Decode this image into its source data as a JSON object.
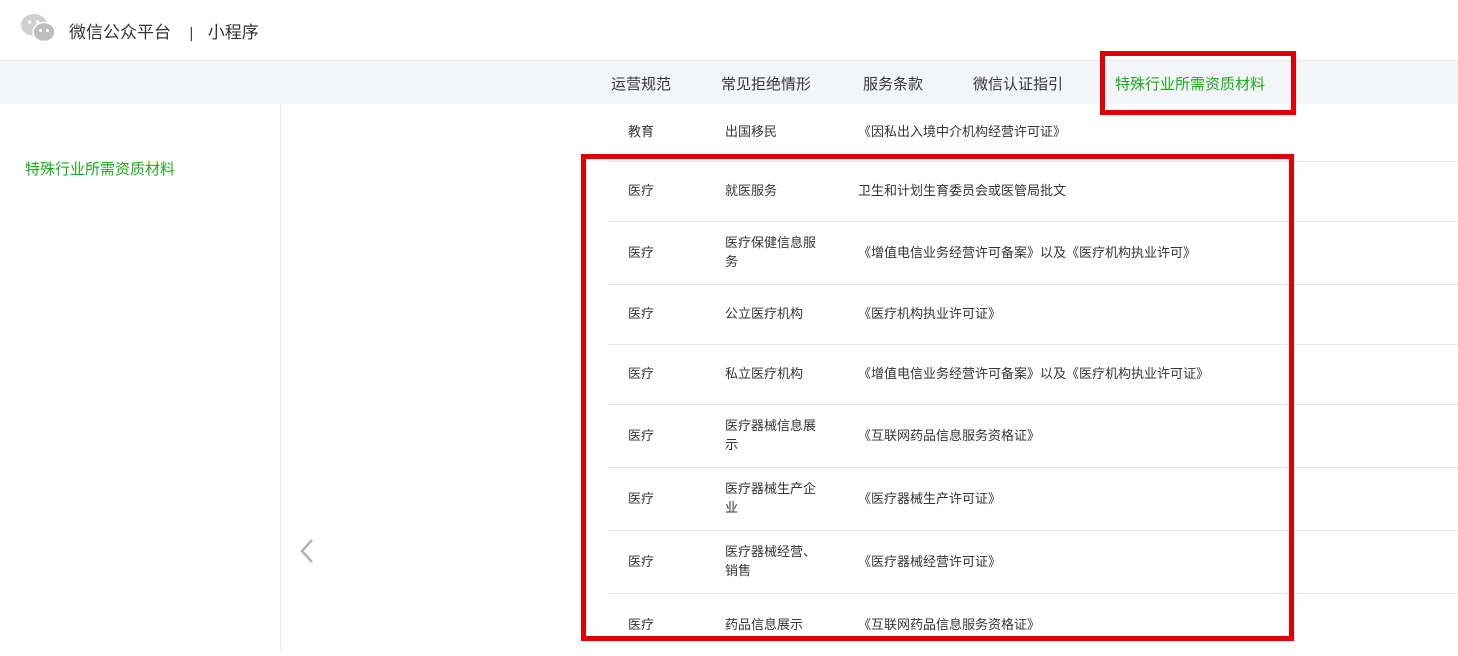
{
  "header": {
    "brand": "微信公众平台",
    "separator": "|",
    "subtitle": "小程序",
    "logo_icon": "wechat-logo-icon"
  },
  "nav": {
    "tabs": [
      {
        "label": "运营规范"
      },
      {
        "label": "常见拒绝情形"
      },
      {
        "label": "服务条款"
      },
      {
        "label": "微信认证指引"
      },
      {
        "label": "特殊行业所需资质材料",
        "active": true
      }
    ]
  },
  "sidebar": {
    "items": [
      {
        "label": "特殊行业所需资质材料",
        "active": true
      }
    ]
  },
  "table": {
    "rows": [
      {
        "industry": "教育",
        "category": "出国移民",
        "material": "《因私出入境中介机构经营许可证》"
      },
      {
        "industry": "医疗",
        "category": "就医服务",
        "material": "卫生和计划生育委员会或医管局批文"
      },
      {
        "industry": "医疗",
        "category": "医疗保健信息服务",
        "material": "《增值电信业务经营许可备案》以及《医疗机构执业许可》"
      },
      {
        "industry": "医疗",
        "category": "公立医疗机构",
        "material": "《医疗机构执业许可证》"
      },
      {
        "industry": "医疗",
        "category": "私立医疗机构",
        "material": "《增值电信业务经营许可备案》以及《医疗机构执业许可证》"
      },
      {
        "industry": "医疗",
        "category": "医疗器械信息展示",
        "material": "《互联网药品信息服务资格证》"
      },
      {
        "industry": "医疗",
        "category": "医疗器械生产企业",
        "material": "《医疗器械生产许可证》"
      },
      {
        "industry": "医疗",
        "category": "医疗器械经营、销售",
        "material": "《医疗器械经营许可证》"
      },
      {
        "industry": "医疗",
        "category": "药品信息展示",
        "material": "《互联网药品信息服务资格证》"
      }
    ]
  },
  "colors": {
    "accent_green": "#1aad19",
    "highlight_red": "#e00000",
    "nav_bg": "#f4f5f9"
  }
}
